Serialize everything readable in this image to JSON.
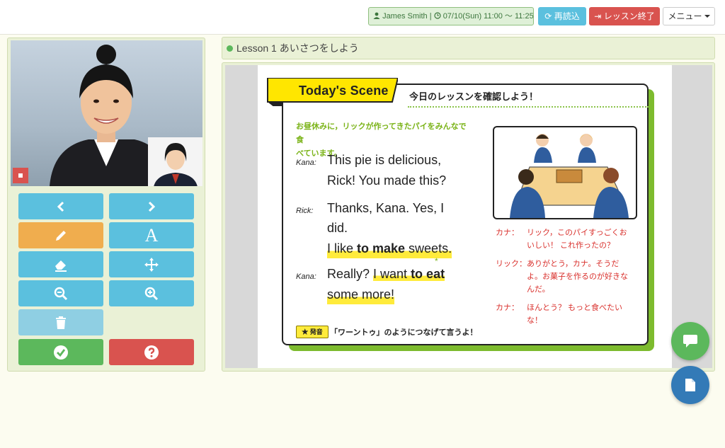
{
  "header": {
    "user_name": "James Smith",
    "separator": "|",
    "schedule": "07/10(Sun) 11:00 〜 11:25",
    "reload_label": "再読込",
    "end_lesson_label": "レッスン終了",
    "menu_label": "メニュー"
  },
  "lesson": {
    "title": "Lesson 1 あいさつをしよう"
  },
  "material": {
    "scene_title": "Today's Scene",
    "scene_subtitle": "今日のレッスンを確認しよう！",
    "intro_line1": "お昼休みに，リックが作ってきたパイをみんなで食",
    "intro_line2": "べています。",
    "dialogue": [
      {
        "speaker": "Kana:",
        "line1": "This pie is delicious,",
        "line2": "Rick!  You made this?"
      },
      {
        "speaker": "Rick:",
        "line1": "Thanks, Kana.  Yes, I",
        "line2": "did.",
        "line3_a": "I like ",
        "line3_b": "to make",
        "line3_c": " sweets."
      },
      {
        "speaker": "Kana:",
        "line1_a": "Really?  ",
        "line1_b": "I want ",
        "line1_c": "to eat",
        "line2": "some more!"
      }
    ],
    "translation": [
      {
        "speaker": "カナ：",
        "line1": "リック，このパイすっごくお",
        "line2": "いしい！  これ作ったの？"
      },
      {
        "speaker": "リック：",
        "line1": "ありがとう，カナ。そうだ",
        "line2": "よ。お菓子を作るのが好きな",
        "line3": "んだ。"
      },
      {
        "speaker": "カナ：",
        "line1": "ほんとう？  もっと食べたい",
        "line2": "な！"
      }
    ],
    "pronunciation_badge": "★ 発音",
    "pronunciation_tip": "「ワーントゥ」のようにつなげて言うよ！"
  },
  "colors": {
    "accent_green": "#5cb85c",
    "info_blue": "#5bc0de",
    "danger_red": "#d9534f",
    "warning_orange": "#f0ad4e",
    "primary_blue": "#337ab7"
  },
  "tools": [
    {
      "icon": "chevron-left-icon"
    },
    {
      "icon": "chevron-right-icon"
    },
    {
      "icon": "pencil-icon"
    },
    {
      "icon": "text-icon",
      "label": "A"
    },
    {
      "icon": "eraser-icon"
    },
    {
      "icon": "move-icon"
    },
    {
      "icon": "zoom-out-icon"
    },
    {
      "icon": "zoom-in-icon"
    },
    {
      "icon": "trash-icon"
    },
    {
      "icon": "check-icon"
    },
    {
      "icon": "help-icon"
    }
  ]
}
